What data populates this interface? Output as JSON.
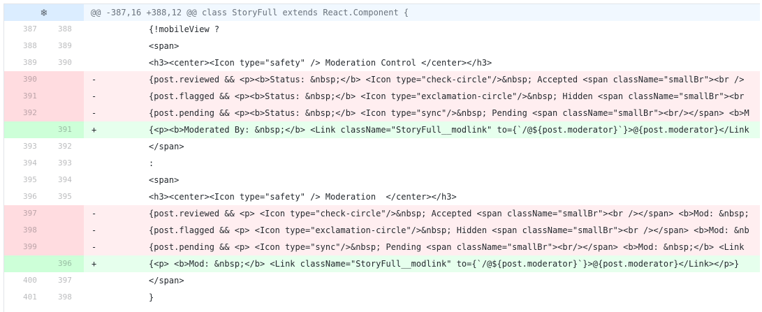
{
  "hunk": {
    "expand_icon": "unfold-icon",
    "header": "@@ -387,16 +388,12 @@ class StoryFull extends React.Component {"
  },
  "lines": [
    {
      "type": "ctx",
      "old": "387",
      "new": "388",
      "marker": "",
      "code": "{!mobileView ?"
    },
    {
      "type": "ctx",
      "old": "388",
      "new": "389",
      "marker": "",
      "code": "<span>"
    },
    {
      "type": "ctx",
      "old": "389",
      "new": "390",
      "marker": "",
      "code": "<h3><center><Icon type=\"safety\" /> Moderation Control </center></h3>"
    },
    {
      "type": "del",
      "old": "390",
      "new": "",
      "marker": "-",
      "code": "{post.reviewed && <p><b>Status: &nbsp;</b> <Icon type=\"check-circle\"/>&nbsp; Accepted <span className=\"smallBr\"><br />"
    },
    {
      "type": "del",
      "old": "391",
      "new": "",
      "marker": "-",
      "code": "{post.flagged && <p><b>Status: &nbsp;</b> <Icon type=\"exclamation-circle\"/>&nbsp; Hidden <span className=\"smallBr\"><br"
    },
    {
      "type": "del",
      "old": "392",
      "new": "",
      "marker": "-",
      "code": "{post.pending && <p><b>Status: &nbsp;</b> <Icon type=\"sync\"/>&nbsp; Pending <span className=\"smallBr\"><br/></span> <b>M"
    },
    {
      "type": "add",
      "old": "",
      "new": "391",
      "marker": "+",
      "code": "{<p><b>Moderated By: &nbsp;</b> <Link className=\"StoryFull__modlink\" to={`/@${post.moderator}`}>@{post.moderator}</Link"
    },
    {
      "type": "ctx",
      "old": "393",
      "new": "392",
      "marker": "",
      "code": "</span>"
    },
    {
      "type": "ctx",
      "old": "394",
      "new": "393",
      "marker": "",
      "code": ":"
    },
    {
      "type": "ctx",
      "old": "395",
      "new": "394",
      "marker": "",
      "code": "<span>"
    },
    {
      "type": "ctx",
      "old": "396",
      "new": "395",
      "marker": "",
      "code": "<h3><center><Icon type=\"safety\" /> Moderation  </center></h3>"
    },
    {
      "type": "del",
      "old": "397",
      "new": "",
      "marker": "-",
      "code": "{post.reviewed && <p> <Icon type=\"check-circle\"/>&nbsp; Accepted <span className=\"smallBr\"><br /></span> <b>Mod: &nbsp;"
    },
    {
      "type": "del",
      "old": "398",
      "new": "",
      "marker": "-",
      "code": "{post.flagged && <p> <Icon type=\"exclamation-circle\"/>&nbsp; Hidden <span className=\"smallBr\"><br /></span> <b>Mod: &nb"
    },
    {
      "type": "del",
      "old": "399",
      "new": "",
      "marker": "-",
      "code": "{post.pending && <p> <Icon type=\"sync\"/>&nbsp; Pending <span className=\"smallBr\"><br/></span> <b>Mod: &nbsp;</b> <Link"
    },
    {
      "type": "add",
      "old": "",
      "new": "396",
      "marker": "+",
      "code": "{<p> <b>Mod: &nbsp;</b> <Link className=\"StoryFull__modlink\" to={`/@${post.moderator}`}>@{post.moderator}</Link></p>}"
    },
    {
      "type": "ctx",
      "old": "400",
      "new": "397",
      "marker": "",
      "code": "</span>"
    },
    {
      "type": "ctx",
      "old": "401",
      "new": "398",
      "marker": "",
      "code": "}"
    }
  ]
}
